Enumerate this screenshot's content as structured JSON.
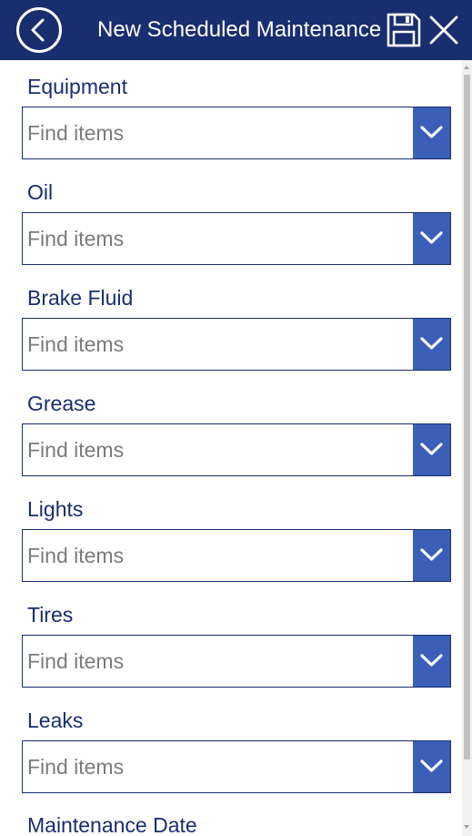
{
  "header": {
    "title": "New Scheduled Maintenance"
  },
  "colors": {
    "header_bg": "#192e6e",
    "label_text": "#192e6e",
    "dropdown_button": "#3b5fb8",
    "placeholder_text": "#7b7b7b"
  },
  "icons": {
    "back": "back-arrow-circle-icon",
    "save": "save-floppy-icon",
    "close": "close-x-icon",
    "dropdown": "chevron-down-icon"
  },
  "form": {
    "fields": [
      {
        "label": "Equipment",
        "placeholder": "Find items"
      },
      {
        "label": "Oil",
        "placeholder": "Find items"
      },
      {
        "label": "Brake Fluid",
        "placeholder": "Find items"
      },
      {
        "label": "Grease",
        "placeholder": "Find items"
      },
      {
        "label": "Lights",
        "placeholder": "Find items"
      },
      {
        "label": "Tires",
        "placeholder": "Find items"
      },
      {
        "label": "Leaks",
        "placeholder": "Find items"
      }
    ],
    "maintenance_date_label": "Maintenance Date"
  }
}
